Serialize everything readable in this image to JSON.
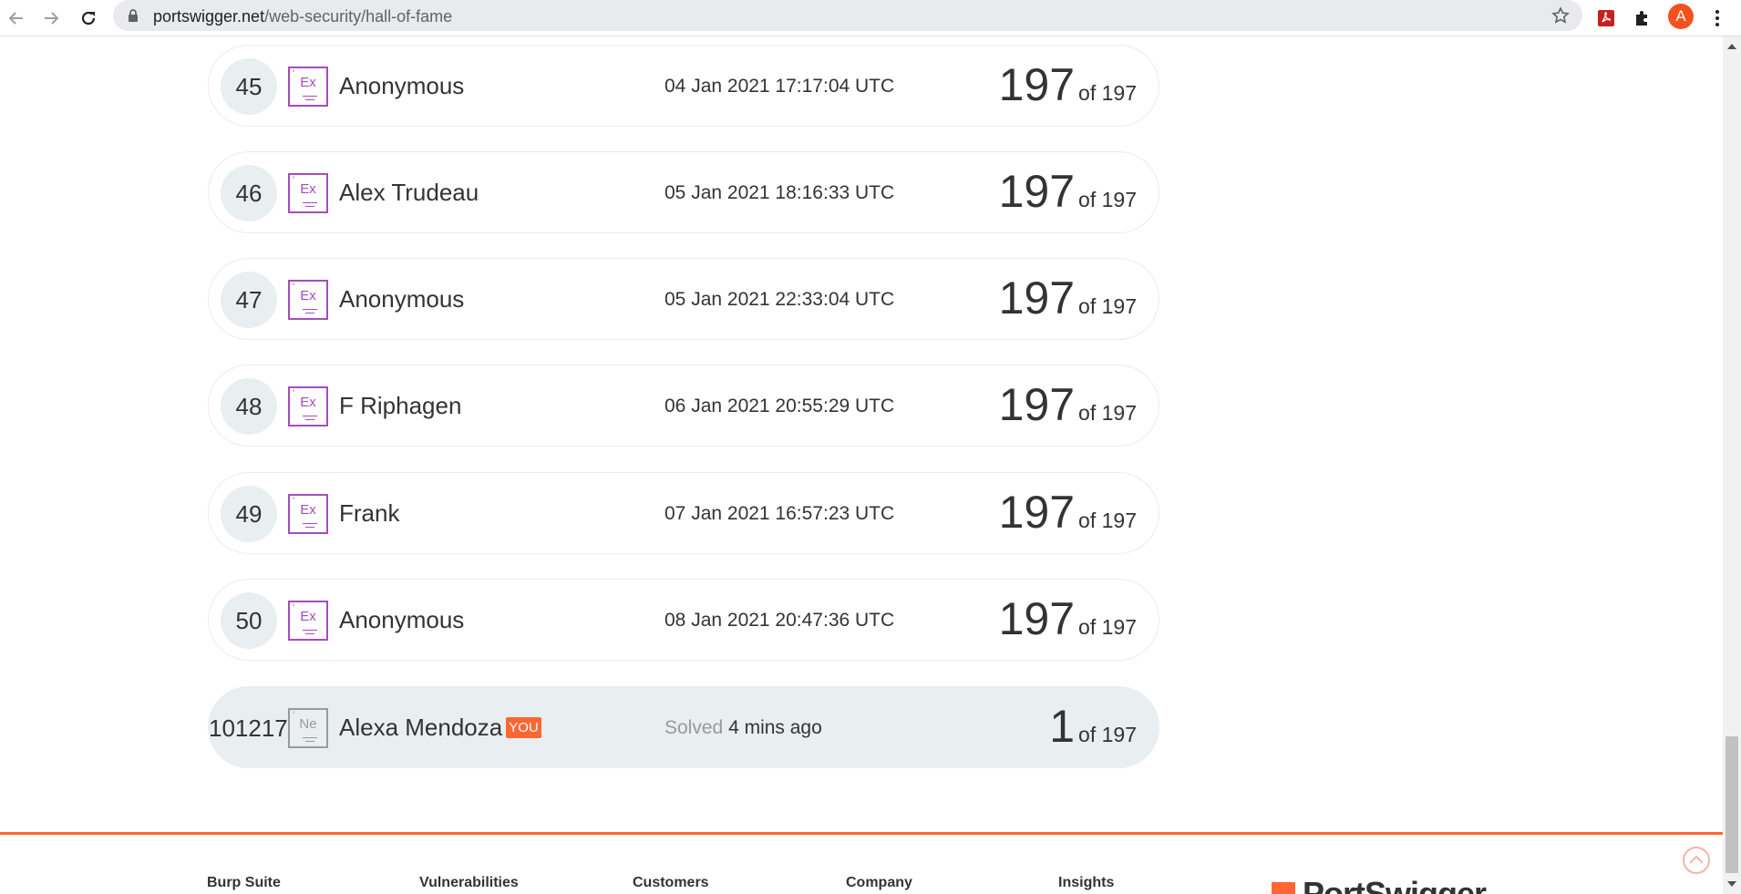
{
  "browser": {
    "url_host": "portswigger.net",
    "url_path": "/web-security/hall-of-fame",
    "profile_initial": "A",
    "accent": "#f4511e"
  },
  "leaderboard": {
    "rows": [
      {
        "rank": "45",
        "level": "Ex",
        "name": "Anonymous",
        "date": "04 Jan 2021 17:17:04 UTC",
        "score": "197",
        "of": "of 197"
      },
      {
        "rank": "46",
        "level": "Ex",
        "name": "Alex Trudeau",
        "date": "05 Jan 2021 18:16:33 UTC",
        "score": "197",
        "of": "of 197"
      },
      {
        "rank": "47",
        "level": "Ex",
        "name": "Anonymous",
        "date": "05 Jan 2021 22:33:04 UTC",
        "score": "197",
        "of": "of 197"
      },
      {
        "rank": "48",
        "level": "Ex",
        "name": "F Riphagen",
        "date": "06 Jan 2021 20:55:29 UTC",
        "score": "197",
        "of": "of 197"
      },
      {
        "rank": "49",
        "level": "Ex",
        "name": "Frank",
        "date": "07 Jan 2021 16:57:23 UTC",
        "score": "197",
        "of": "of 197"
      },
      {
        "rank": "50",
        "level": "Ex",
        "name": "Anonymous",
        "date": "08 Jan 2021 20:47:36 UTC",
        "score": "197",
        "of": "of 197"
      }
    ],
    "current_user": {
      "rank": "101217",
      "level": "Ne",
      "name": "Alexa Mendoza",
      "you_label": "YOU",
      "solved_prefix": "Solved",
      "solved_time": "4 mins ago",
      "score": "1",
      "of": "of 197"
    },
    "level_badge_color": "#a44dbb",
    "you_tag_color": "#ff6633"
  },
  "footer": {
    "columns": [
      "Burp Suite",
      "Vulnerabilities",
      "Customers",
      "Company",
      "Insights"
    ],
    "logo_text": "PortSwigger",
    "accent": "#ff6633"
  }
}
